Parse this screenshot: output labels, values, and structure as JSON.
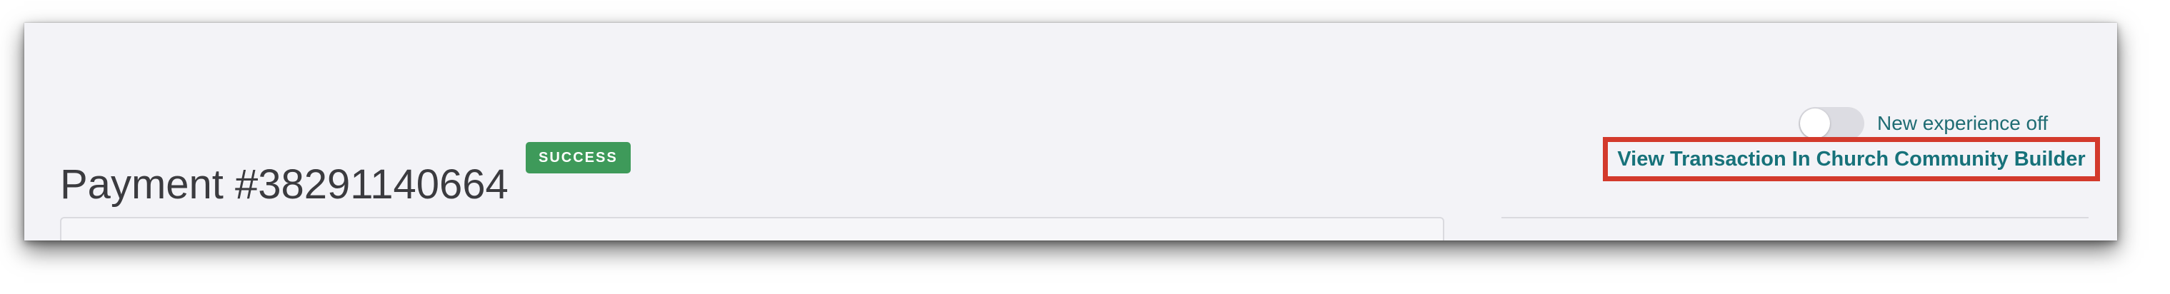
{
  "page": {
    "title": "Payment #38291140664",
    "status_badge": "SUCCESS"
  },
  "header_actions": {
    "toggle": {
      "label": "New experience off",
      "state": "off"
    },
    "view_transaction_link": "View Transaction In Church Community Builder"
  },
  "colors": {
    "page_background": "#f3f3f7",
    "badge_background": "#3e9a5a",
    "link_color": "#17727a",
    "highlight_border": "#d33a2c",
    "title_color": "#3b3b3f"
  },
  "icons": {
    "toggle": "toggle-switch-off-icon"
  }
}
